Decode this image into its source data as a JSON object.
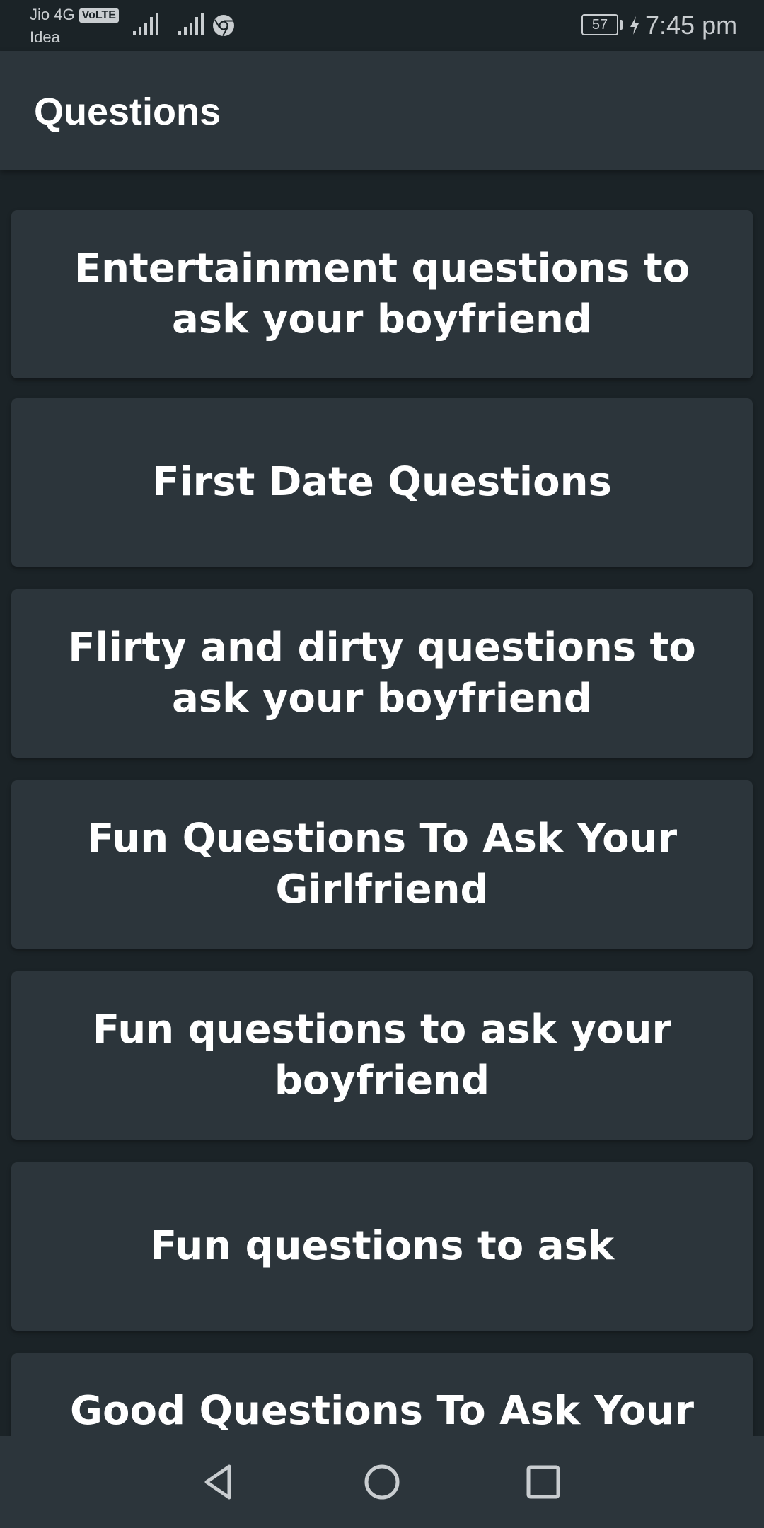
{
  "status_bar": {
    "carrier_primary": "Jio 4G",
    "volte_badge": "VoLTE",
    "carrier_secondary": "Idea",
    "battery_level": "57",
    "time": "7:45 pm",
    "icons": [
      "signal-strength-icon",
      "signal-strength-icon",
      "chrome-icon",
      "battery-icon",
      "charging-bolt-icon"
    ]
  },
  "app_bar": {
    "title": "Questions"
  },
  "list": {
    "items": [
      {
        "label": "Entertainment questions to ask your boyfriend"
      },
      {
        "label": "First Date Questions"
      },
      {
        "label": "Flirty and dirty questions to ask your boyfriend"
      },
      {
        "label": "Fun Questions To Ask Your Girlfriend"
      },
      {
        "label": "Fun questions to ask your boyfriend"
      },
      {
        "label": "Fun questions to ask"
      },
      {
        "label": "Good Questions To Ask Your"
      }
    ]
  },
  "nav_bar": {
    "icons": [
      "back-icon",
      "home-icon",
      "recent-apps-icon"
    ]
  },
  "colors": {
    "background": "#1b2327",
    "surface": "#2c353b",
    "text": "#ffffff",
    "status_text": "#c9cdd0"
  }
}
